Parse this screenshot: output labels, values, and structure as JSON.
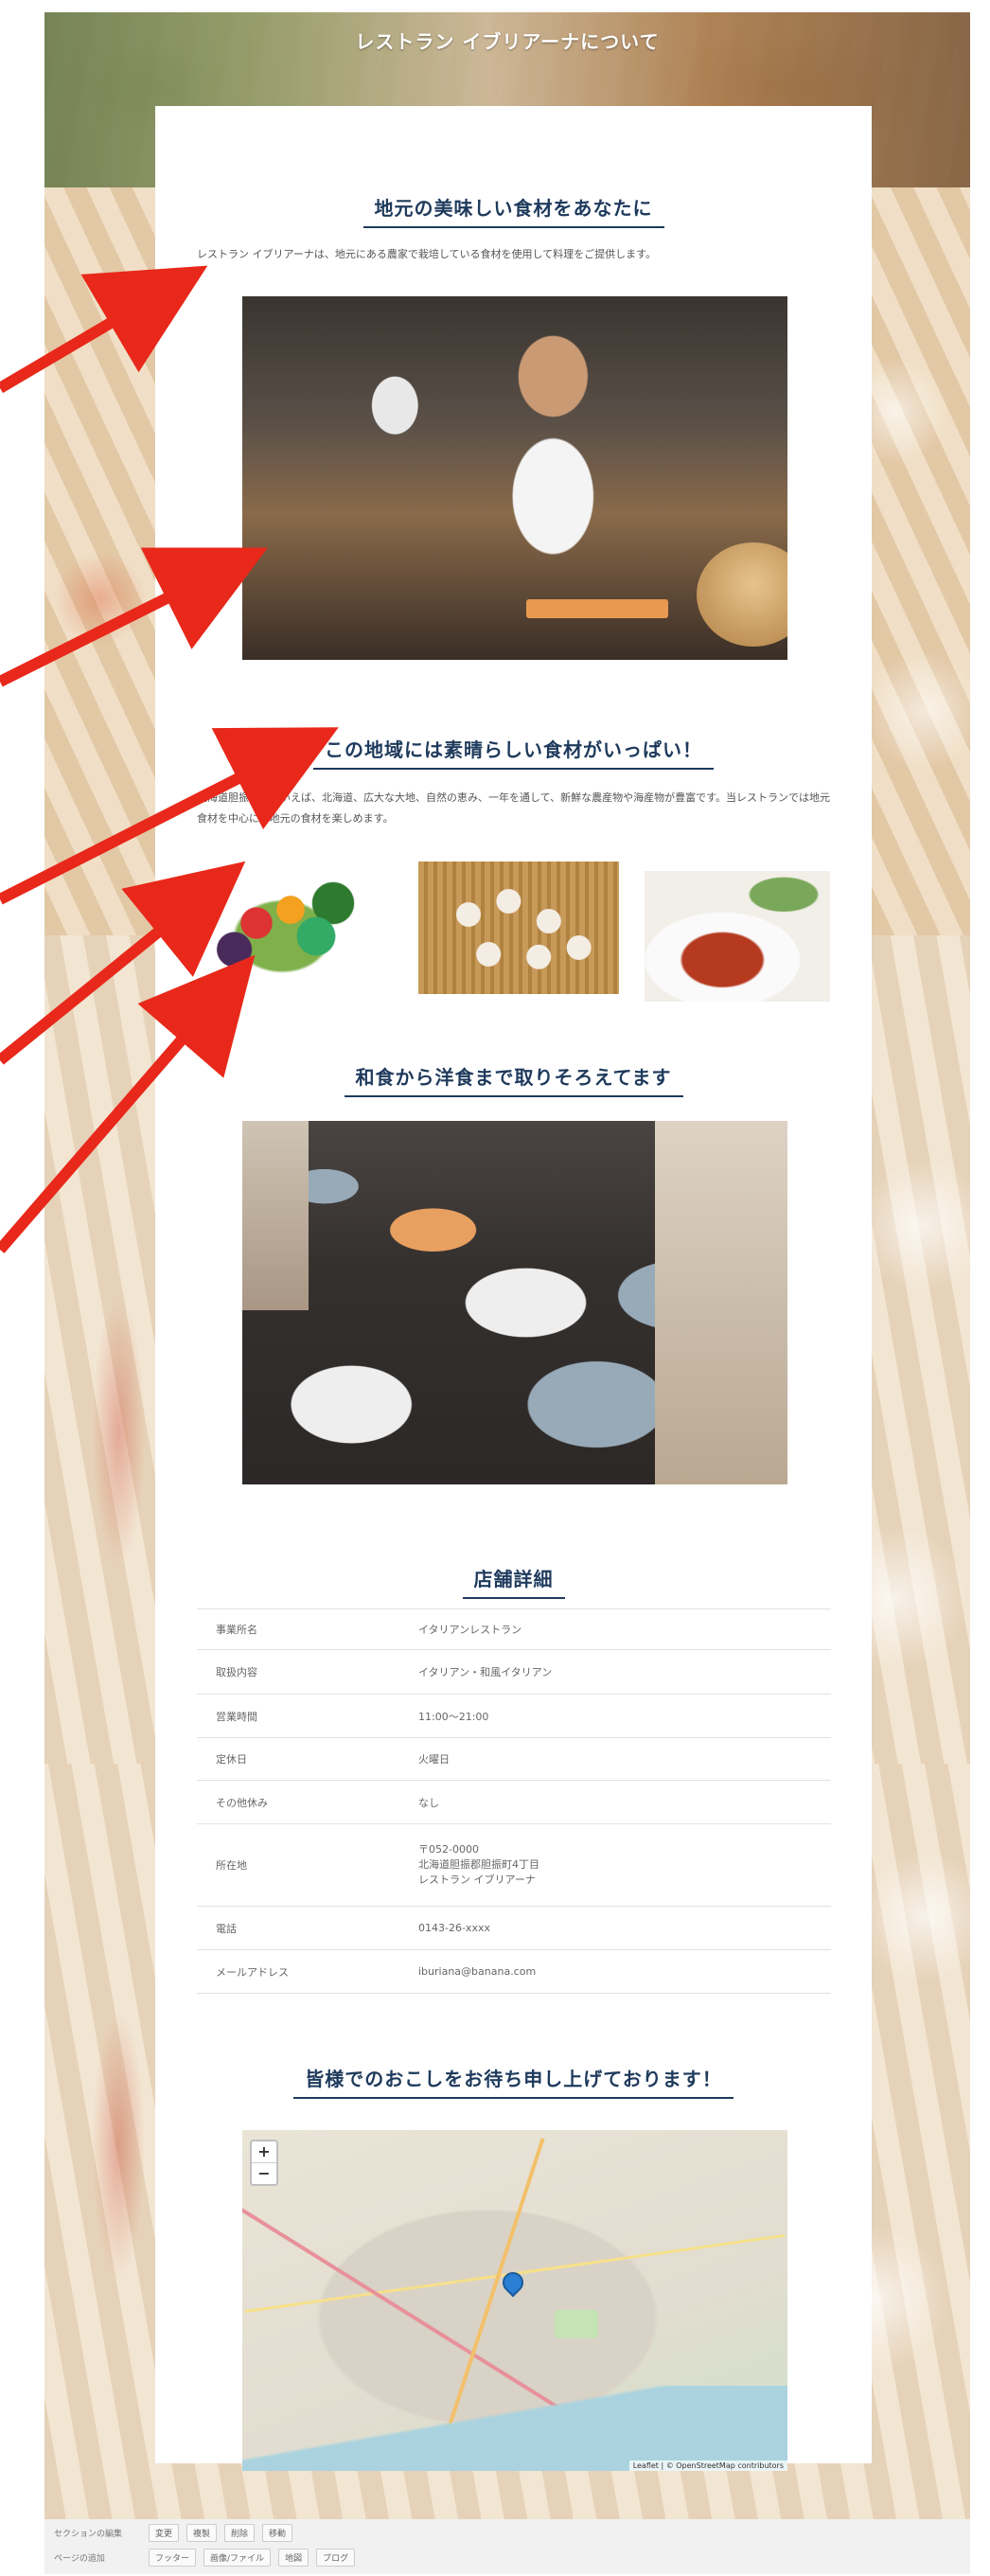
{
  "page": {
    "title": "レストラン イブリアーナについて"
  },
  "section1": {
    "heading": "地元の美味しい食材をあなたに",
    "text": "レストラン イブリアーナは、地元にある農家で栽培している食材を使用して料理をご提供します。"
  },
  "section2": {
    "heading": "この地域には素晴らしい食材がいっぱい！",
    "text": "北海道胆振地域といえば、北海道、広大な大地、自然の恵み、一年を通して、新鮮な農産物や海産物が豊富です。当レストランでは地元食材を中心に、地元の食材を楽しめます。"
  },
  "section3": {
    "heading": "和食から洋食まで取りそろえてます"
  },
  "section4": {
    "heading": "店舗詳細",
    "rows": [
      {
        "k": "事業所名",
        "v": "イタリアンレストラン"
      },
      {
        "k": "取扱内容",
        "v": "イタリアン・和風イタリアン"
      },
      {
        "k": "営業時間",
        "v": "11:00～21:00"
      },
      {
        "k": "定休日",
        "v": "火曜日"
      },
      {
        "k": "その他休み",
        "v": "なし"
      },
      {
        "k": "所在地",
        "v": "〒052-0000",
        "v2": "北海道胆振郡胆振町4丁目",
        "v3": "レストラン イブリアーナ"
      },
      {
        "k": "電話",
        "v": "0143-26-xxxx"
      },
      {
        "k": "メールアドレス",
        "v": "iburiana@banana.com"
      }
    ]
  },
  "section5": {
    "heading": "皆様でのおこしをお待ち申し上げております！",
    "map_zoom_in": "+",
    "map_zoom_out": "−",
    "map_attribution": "Leaflet | © OpenStreetMap contributors"
  },
  "admin": {
    "row1_label": "セクションの編集",
    "row1_buttons": [
      "変更",
      "複製",
      "削除",
      "移動"
    ],
    "row2_label": "ページの追加",
    "row2_buttons": [
      "フッター",
      "画像/ファイル",
      "地図",
      "ブログ"
    ]
  },
  "colors": {
    "heading": "#1e3a5c",
    "arrow": "#e8281a"
  }
}
